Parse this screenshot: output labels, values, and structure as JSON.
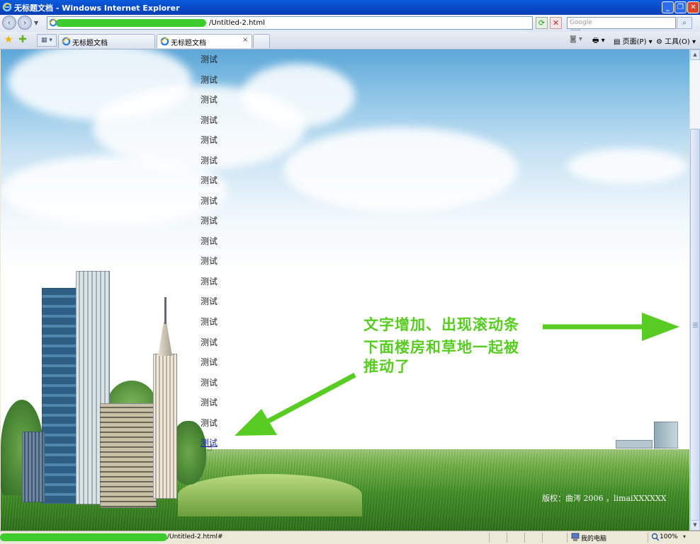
{
  "window": {
    "title": "无标题文档 - Windows Internet Explorer",
    "minimize": "_",
    "maximize": "❐",
    "close": "✕"
  },
  "address_bar": {
    "url_suffix": "/Untitled-2.html",
    "search_placeholder": "Google"
  },
  "tabs": [
    {
      "label": "无标题文档",
      "active": false
    },
    {
      "label": "无标题文档",
      "active": true,
      "close": "×"
    }
  ],
  "command_bar": {
    "page_label": "页面(P)",
    "tools_label": "工具(O)"
  },
  "content": {
    "list_items": [
      "测试",
      "测试",
      "测试",
      "测试",
      "测试",
      "测试",
      "测试",
      "测试",
      "测试",
      "测试",
      "测试",
      "测试",
      "测试",
      "测试",
      "测试",
      "测试",
      "测试",
      "测试",
      "测试",
      "测试"
    ],
    "annotation_lines": [
      "文字增加、出现滚动条",
      "下面楼房和草地一起被",
      "推动了"
    ],
    "copyright": "版权：曲涔  2006  ，limaiXXXXXX"
  },
  "status_bar": {
    "url_suffix": "/Untitled-2.html#",
    "zone": "我的电脑",
    "zoom": "100%"
  },
  "colors": {
    "annotation_green": "#58CC22",
    "redaction_green": "#3DCB2E",
    "title_bar_blue": "#0A5BDB"
  }
}
